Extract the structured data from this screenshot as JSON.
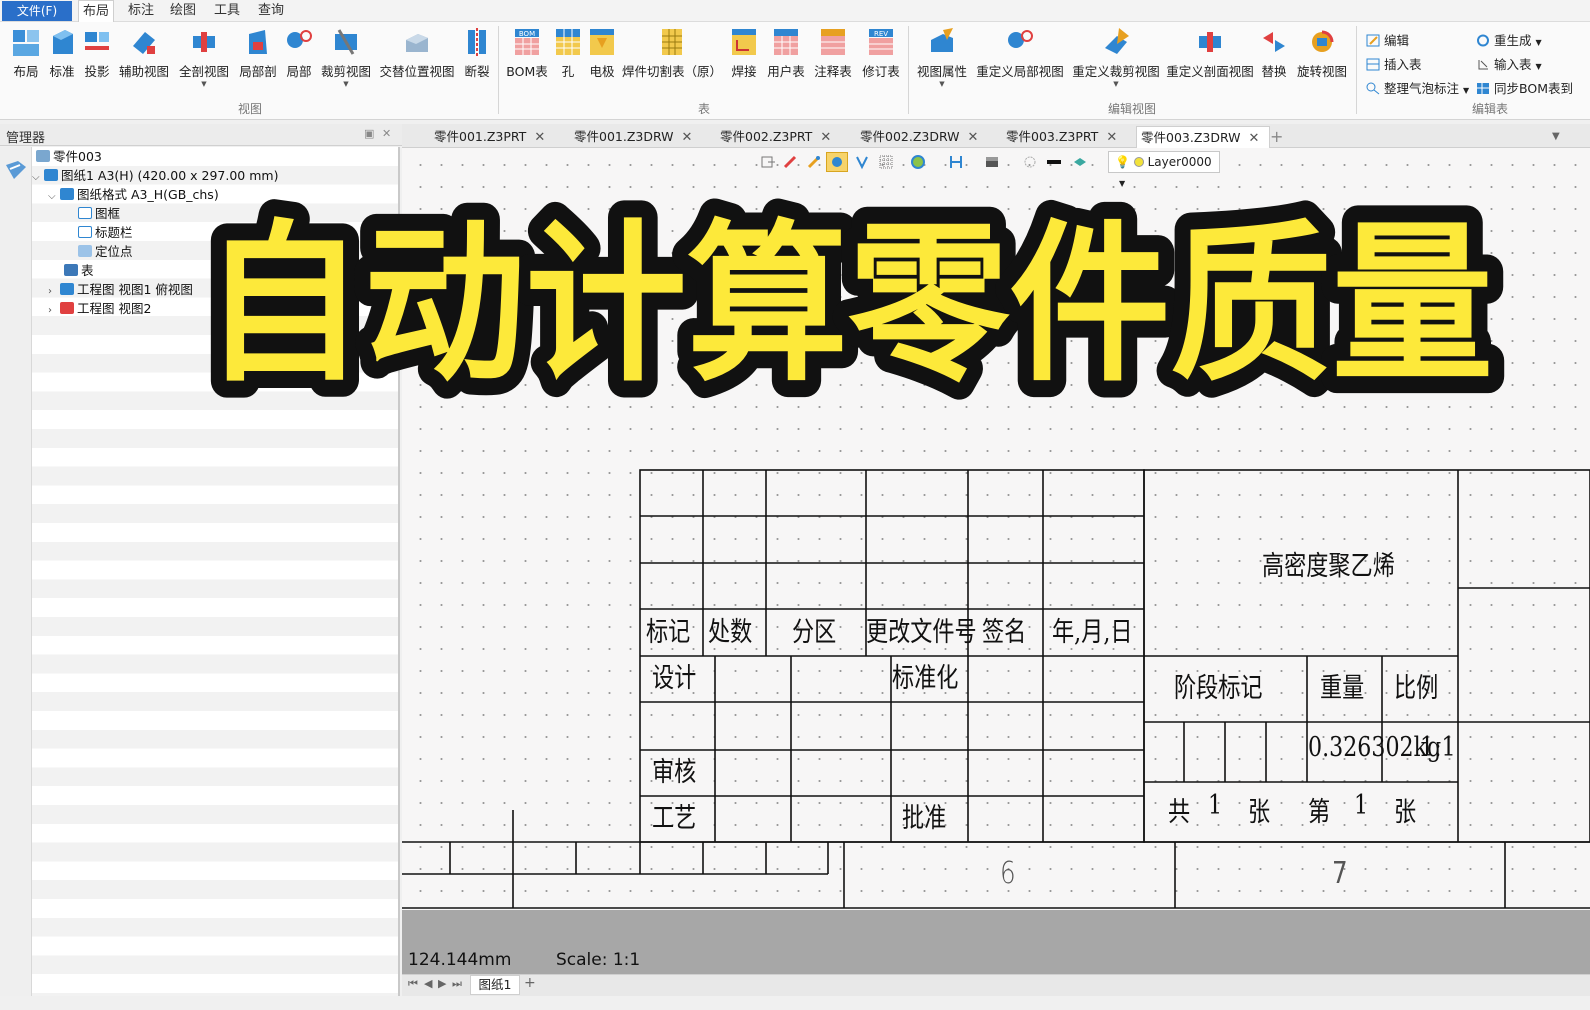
{
  "menubar": {
    "file": "文件(F)",
    "tabs": [
      "布局",
      "标注",
      "绘图",
      "工具",
      "查询"
    ],
    "active_tab": "布局"
  },
  "ribbon": {
    "view_group": {
      "label": "视图",
      "buttons": [
        "布局",
        "标准",
        "投影",
        "辅助视图",
        "全剖视图",
        "局部剖",
        "局部",
        "裁剪视图",
        "交替位置视图",
        "断裂"
      ]
    },
    "table_group": {
      "label": "表",
      "buttons": [
        "BOM表",
        "孔",
        "电极",
        "焊件切割表（原）",
        "焊接",
        "用户表",
        "注释表",
        "修订表"
      ]
    },
    "edit_view_group": {
      "label": "编辑视图",
      "buttons": [
        "视图属性",
        "重定义局部视图",
        "重定义裁剪视图",
        "重定义剖面视图",
        "替换",
        "旋转视图"
      ]
    },
    "edit_table_group": {
      "label": "编辑表",
      "small_buttons": [
        "编辑",
        "插入表",
        "整理气泡标注",
        "重生成",
        "输入表",
        "同步BOM表到"
      ]
    }
  },
  "manager": {
    "title": "管理器",
    "tree": [
      {
        "label": "零件003"
      },
      {
        "label": "图纸1 A3(H) (420.00 x 297.00 mm)"
      },
      {
        "label": "图纸格式 A3_H(GB_chs)"
      },
      {
        "label": "图框"
      },
      {
        "label": "标题栏"
      },
      {
        "label": "定位点"
      },
      {
        "label": "表"
      },
      {
        "label": "工程图 视图1 俯视图"
      },
      {
        "label": "工程图 视图2"
      }
    ]
  },
  "doc_tabs": [
    "零件001.Z3PRT",
    "零件001.Z3DRW",
    "零件002.Z3PRT",
    "零件002.Z3DRW",
    "零件003.Z3PRT",
    "零件003.Z3DRW"
  ],
  "active_doc": "零件003.Z3DRW",
  "layer": "Layer0000",
  "overlay_title": "自动计算零件质量",
  "title_block": {
    "material": "高密度聚乙烯",
    "headers": [
      "标记",
      "处数",
      "分区",
      "更改文件号",
      "签名",
      "年,月,日"
    ],
    "design": "设计",
    "standardize": "标准化",
    "review": "审核",
    "process": "工艺",
    "approve": "批准",
    "stage_mark": "阶段标记",
    "weight_label": "重量",
    "scale_label": "比例",
    "weight_value": "0.326302kg",
    "scale_value": "1:1",
    "total": "共",
    "total_num": "1",
    "sheets_word": "张",
    "nth": "第",
    "nth_num": "1",
    "zone_6": "6",
    "zone_7": "7"
  },
  "status": {
    "coord": "124.144mm",
    "scale": "Scale: 1:1"
  },
  "sheet_tab": "图纸1",
  "colors": {
    "accent_blue": "#2a6fc9",
    "overlay_fill": "#fde93a",
    "overlay_stroke": "#111111"
  }
}
